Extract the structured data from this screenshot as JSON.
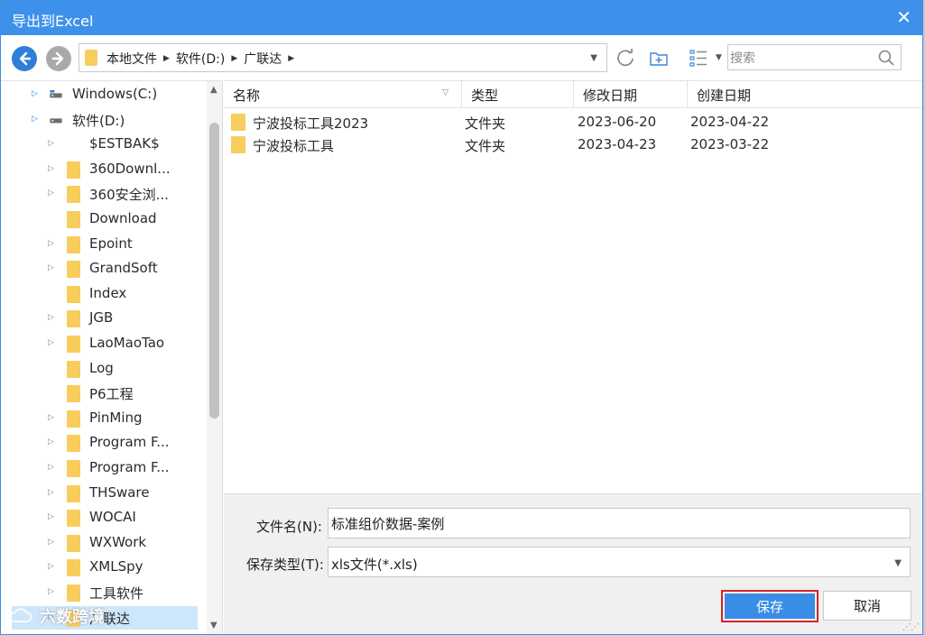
{
  "dialog": {
    "title": "导出到Excel",
    "close_icon": "close-icon"
  },
  "toolbar": {
    "back_icon": "arrow-left-icon",
    "forward_icon": "arrow-right-icon",
    "path": [
      "本地文件",
      "软件(D:)",
      "广联达"
    ],
    "search_placeholder": "搜索"
  },
  "tree": {
    "items": [
      {
        "label": "Windows(C:)",
        "kind": "drive-c",
        "level": 0
      },
      {
        "label": "软件(D:)",
        "kind": "drive-d",
        "level": 0
      },
      {
        "label": "$ESTBAK$",
        "kind": "none",
        "level": 1
      },
      {
        "label": "360Downl...",
        "kind": "folder",
        "level": 1
      },
      {
        "label": "360安全浏...",
        "kind": "folder",
        "level": 1
      },
      {
        "label": "Download",
        "kind": "folder",
        "level": 1
      },
      {
        "label": "Epoint",
        "kind": "folder",
        "level": 1
      },
      {
        "label": "GrandSoft",
        "kind": "folder",
        "level": 1
      },
      {
        "label": "Index",
        "kind": "folder",
        "level": 1
      },
      {
        "label": "JGB",
        "kind": "folder",
        "level": 1
      },
      {
        "label": "LaoMaoTao",
        "kind": "folder",
        "level": 1
      },
      {
        "label": "Log",
        "kind": "folder",
        "level": 1
      },
      {
        "label": "P6工程",
        "kind": "folder",
        "level": 1
      },
      {
        "label": "PinMing",
        "kind": "folder",
        "level": 1
      },
      {
        "label": "Program F...",
        "kind": "folder",
        "level": 1
      },
      {
        "label": "Program F...",
        "kind": "folder",
        "level": 1
      },
      {
        "label": "THSware",
        "kind": "folder",
        "level": 1
      },
      {
        "label": "WOCAI",
        "kind": "folder",
        "level": 1
      },
      {
        "label": "WXWork",
        "kind": "folder",
        "level": 1
      },
      {
        "label": "XMLSpy",
        "kind": "folder",
        "level": 1
      },
      {
        "label": "工具软件",
        "kind": "folder",
        "level": 1
      },
      {
        "label": "广联达",
        "kind": "folder",
        "level": 1
      }
    ]
  },
  "filelist": {
    "columns": [
      "名称",
      "类型",
      "修改日期",
      "创建日期"
    ],
    "rows": [
      {
        "name": "宁波投标工具2023",
        "type": "文件夹",
        "modified": "2023-06-20",
        "created": "2023-04-22"
      },
      {
        "name": "宁波投标工具",
        "type": "文件夹",
        "modified": "2023-04-23",
        "created": "2023-03-22"
      }
    ]
  },
  "form": {
    "filename_label": "文件名(N):",
    "filename_value": "标准组价数据-案例",
    "filetype_label": "保存类型(T):",
    "filetype_value": "xls文件(*.xls)",
    "save_label": "保存",
    "cancel_label": "取消"
  },
  "watermark": {
    "text": "六数跨境"
  },
  "colors": {
    "titlebar": "#3d91eb",
    "folder": "#f7cd5c",
    "primary_button": "#3a8de6",
    "highlight_border": "#d32525",
    "selected_row": "#cde6fb"
  }
}
